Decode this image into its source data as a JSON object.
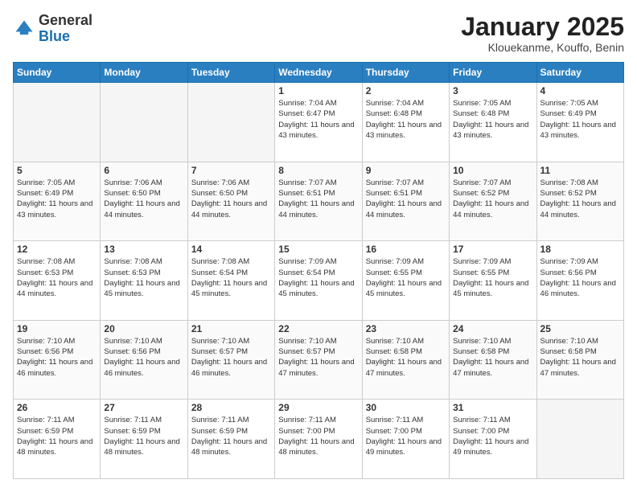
{
  "header": {
    "logo_general": "General",
    "logo_blue": "Blue",
    "month_title": "January 2025",
    "location": "Klouekanme, Kouffo, Benin"
  },
  "days_of_week": [
    "Sunday",
    "Monday",
    "Tuesday",
    "Wednesday",
    "Thursday",
    "Friday",
    "Saturday"
  ],
  "weeks": [
    [
      {
        "day": "",
        "sunrise": "",
        "sunset": "",
        "daylight": ""
      },
      {
        "day": "",
        "sunrise": "",
        "sunset": "",
        "daylight": ""
      },
      {
        "day": "",
        "sunrise": "",
        "sunset": "",
        "daylight": ""
      },
      {
        "day": "1",
        "sunrise": "Sunrise: 7:04 AM",
        "sunset": "Sunset: 6:47 PM",
        "daylight": "Daylight: 11 hours and 43 minutes."
      },
      {
        "day": "2",
        "sunrise": "Sunrise: 7:04 AM",
        "sunset": "Sunset: 6:48 PM",
        "daylight": "Daylight: 11 hours and 43 minutes."
      },
      {
        "day": "3",
        "sunrise": "Sunrise: 7:05 AM",
        "sunset": "Sunset: 6:48 PM",
        "daylight": "Daylight: 11 hours and 43 minutes."
      },
      {
        "day": "4",
        "sunrise": "Sunrise: 7:05 AM",
        "sunset": "Sunset: 6:49 PM",
        "daylight": "Daylight: 11 hours and 43 minutes."
      }
    ],
    [
      {
        "day": "5",
        "sunrise": "Sunrise: 7:05 AM",
        "sunset": "Sunset: 6:49 PM",
        "daylight": "Daylight: 11 hours and 43 minutes."
      },
      {
        "day": "6",
        "sunrise": "Sunrise: 7:06 AM",
        "sunset": "Sunset: 6:50 PM",
        "daylight": "Daylight: 11 hours and 44 minutes."
      },
      {
        "day": "7",
        "sunrise": "Sunrise: 7:06 AM",
        "sunset": "Sunset: 6:50 PM",
        "daylight": "Daylight: 11 hours and 44 minutes."
      },
      {
        "day": "8",
        "sunrise": "Sunrise: 7:07 AM",
        "sunset": "Sunset: 6:51 PM",
        "daylight": "Daylight: 11 hours and 44 minutes."
      },
      {
        "day": "9",
        "sunrise": "Sunrise: 7:07 AM",
        "sunset": "Sunset: 6:51 PM",
        "daylight": "Daylight: 11 hours and 44 minutes."
      },
      {
        "day": "10",
        "sunrise": "Sunrise: 7:07 AM",
        "sunset": "Sunset: 6:52 PM",
        "daylight": "Daylight: 11 hours and 44 minutes."
      },
      {
        "day": "11",
        "sunrise": "Sunrise: 7:08 AM",
        "sunset": "Sunset: 6:52 PM",
        "daylight": "Daylight: 11 hours and 44 minutes."
      }
    ],
    [
      {
        "day": "12",
        "sunrise": "Sunrise: 7:08 AM",
        "sunset": "Sunset: 6:53 PM",
        "daylight": "Daylight: 11 hours and 44 minutes."
      },
      {
        "day": "13",
        "sunrise": "Sunrise: 7:08 AM",
        "sunset": "Sunset: 6:53 PM",
        "daylight": "Daylight: 11 hours and 45 minutes."
      },
      {
        "day": "14",
        "sunrise": "Sunrise: 7:08 AM",
        "sunset": "Sunset: 6:54 PM",
        "daylight": "Daylight: 11 hours and 45 minutes."
      },
      {
        "day": "15",
        "sunrise": "Sunrise: 7:09 AM",
        "sunset": "Sunset: 6:54 PM",
        "daylight": "Daylight: 11 hours and 45 minutes."
      },
      {
        "day": "16",
        "sunrise": "Sunrise: 7:09 AM",
        "sunset": "Sunset: 6:55 PM",
        "daylight": "Daylight: 11 hours and 45 minutes."
      },
      {
        "day": "17",
        "sunrise": "Sunrise: 7:09 AM",
        "sunset": "Sunset: 6:55 PM",
        "daylight": "Daylight: 11 hours and 45 minutes."
      },
      {
        "day": "18",
        "sunrise": "Sunrise: 7:09 AM",
        "sunset": "Sunset: 6:56 PM",
        "daylight": "Daylight: 11 hours and 46 minutes."
      }
    ],
    [
      {
        "day": "19",
        "sunrise": "Sunrise: 7:10 AM",
        "sunset": "Sunset: 6:56 PM",
        "daylight": "Daylight: 11 hours and 46 minutes."
      },
      {
        "day": "20",
        "sunrise": "Sunrise: 7:10 AM",
        "sunset": "Sunset: 6:56 PM",
        "daylight": "Daylight: 11 hours and 46 minutes."
      },
      {
        "day": "21",
        "sunrise": "Sunrise: 7:10 AM",
        "sunset": "Sunset: 6:57 PM",
        "daylight": "Daylight: 11 hours and 46 minutes."
      },
      {
        "day": "22",
        "sunrise": "Sunrise: 7:10 AM",
        "sunset": "Sunset: 6:57 PM",
        "daylight": "Daylight: 11 hours and 47 minutes."
      },
      {
        "day": "23",
        "sunrise": "Sunrise: 7:10 AM",
        "sunset": "Sunset: 6:58 PM",
        "daylight": "Daylight: 11 hours and 47 minutes."
      },
      {
        "day": "24",
        "sunrise": "Sunrise: 7:10 AM",
        "sunset": "Sunset: 6:58 PM",
        "daylight": "Daylight: 11 hours and 47 minutes."
      },
      {
        "day": "25",
        "sunrise": "Sunrise: 7:10 AM",
        "sunset": "Sunset: 6:58 PM",
        "daylight": "Daylight: 11 hours and 47 minutes."
      }
    ],
    [
      {
        "day": "26",
        "sunrise": "Sunrise: 7:11 AM",
        "sunset": "Sunset: 6:59 PM",
        "daylight": "Daylight: 11 hours and 48 minutes."
      },
      {
        "day": "27",
        "sunrise": "Sunrise: 7:11 AM",
        "sunset": "Sunset: 6:59 PM",
        "daylight": "Daylight: 11 hours and 48 minutes."
      },
      {
        "day": "28",
        "sunrise": "Sunrise: 7:11 AM",
        "sunset": "Sunset: 6:59 PM",
        "daylight": "Daylight: 11 hours and 48 minutes."
      },
      {
        "day": "29",
        "sunrise": "Sunrise: 7:11 AM",
        "sunset": "Sunset: 7:00 PM",
        "daylight": "Daylight: 11 hours and 48 minutes."
      },
      {
        "day": "30",
        "sunrise": "Sunrise: 7:11 AM",
        "sunset": "Sunset: 7:00 PM",
        "daylight": "Daylight: 11 hours and 49 minutes."
      },
      {
        "day": "31",
        "sunrise": "Sunrise: 7:11 AM",
        "sunset": "Sunset: 7:00 PM",
        "daylight": "Daylight: 11 hours and 49 minutes."
      },
      {
        "day": "",
        "sunrise": "",
        "sunset": "",
        "daylight": ""
      }
    ]
  ]
}
